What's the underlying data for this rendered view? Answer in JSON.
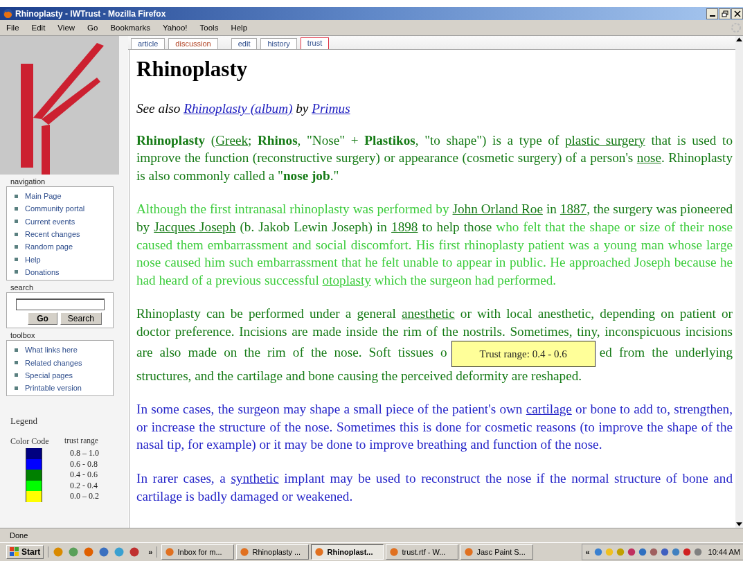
{
  "window": {
    "title": "Rhinoplasty - IWTrust - Mozilla Firefox"
  },
  "menu": [
    "File",
    "Edit",
    "View",
    "Go",
    "Bookmarks",
    "Yahoo!",
    "Tools",
    "Help"
  ],
  "tabs": [
    {
      "label": "article",
      "kind": "page",
      "selected": false
    },
    {
      "label": "discussion",
      "kind": "talk",
      "selected": false
    },
    {
      "label": "edit",
      "kind": "action",
      "selected": false
    },
    {
      "label": "history",
      "kind": "page",
      "selected": false
    },
    {
      "label": "trust",
      "kind": "page",
      "selected": true
    }
  ],
  "sidebar": {
    "navigation": {
      "heading": "navigation",
      "items": [
        "Main Page",
        "Community portal",
        "Current events",
        "Recent changes",
        "Random page",
        "Help",
        "Donations"
      ]
    },
    "search": {
      "heading": "search",
      "buttons": [
        "Go",
        "Search"
      ]
    },
    "toolbox": {
      "heading": "toolbox",
      "items": [
        "What links here",
        "Related changes",
        "Special pages",
        "Printable version"
      ]
    },
    "legend": {
      "title": "Legend",
      "color_header": "Color Code",
      "range_header": "trust range",
      "rows": [
        {
          "color": "#000080",
          "range": "0.8 – 1.0"
        },
        {
          "color": "#0000ff",
          "range": "0.6 - 0.8"
        },
        {
          "color": "#008000",
          "range": "0.4 - 0.6"
        },
        {
          "color": "#00ff00",
          "range": "0.2 - 0.4"
        },
        {
          "color": "#ffff00",
          "range": "0.0 – 0.2"
        }
      ]
    }
  },
  "article": {
    "title": "Rhinoplasty",
    "see_also": [
      {
        "kind": "text",
        "text": "See also "
      },
      {
        "kind": "link",
        "text": "Rhinoplasty (album)"
      },
      {
        "kind": "text",
        "text": " by "
      },
      {
        "kind": "link",
        "text": "Primus"
      }
    ],
    "paragraphs": [
      {
        "segments": [
          {
            "kind": "text",
            "color": "#157a15",
            "text": "**Rhinoplasty** ("
          },
          {
            "kind": "link",
            "color": "#157a15",
            "text": "Greek"
          },
          {
            "kind": "text",
            "color": "#157a15",
            "text": "; **Rhinos**, \"Nose\" + **Plastikos**, \"to shape\") is a type of "
          },
          {
            "kind": "link",
            "color": "#157a15",
            "text": "plastic surgery"
          },
          {
            "kind": "text",
            "color": "#157a15",
            "text": " that is used to improve the function (reconstructive surgery) or appearance (cosmetic surgery) of a person's "
          },
          {
            "kind": "link",
            "color": "#157a15",
            "text": "nose"
          },
          {
            "kind": "text",
            "color": "#157a15",
            "text": ". Rhinoplasty is also commonly called a \"**nose job**.\""
          }
        ]
      },
      {
        "segments": [
          {
            "kind": "text",
            "color": "#3ccc3c",
            "text": "Although the first intranasal rhinoplasty was performed by "
          },
          {
            "kind": "link",
            "color": "#157a15",
            "text": "John Orland Roe"
          },
          {
            "kind": "text",
            "color": "#157a15",
            "text": " in "
          },
          {
            "kind": "link",
            "color": "#157a15",
            "text": "1887"
          },
          {
            "kind": "text",
            "color": "#157a15",
            "text": ", the surgery was pioneered by "
          },
          {
            "kind": "link",
            "color": "#157a15",
            "text": "Jacques Joseph"
          },
          {
            "kind": "text",
            "color": "#157a15",
            "text": " (b. Jakob Lewin Joseph) in "
          },
          {
            "kind": "link",
            "color": "#157a15",
            "text": "1898"
          },
          {
            "kind": "text",
            "color": "#157a15",
            "text": " to help those "
          },
          {
            "kind": "text",
            "color": "#3ccc3c",
            "text": "who felt that the shape or size of their nose caused them embarrassment and social discomfort. His first rhinoplasty patient was a young man whose large nose caused him such embarrassment that he felt unable to appear in public. He approached Joseph because he had heard of a previous successful "
          },
          {
            "kind": "link",
            "color": "#3ccc3c",
            "text": "otoplasty"
          },
          {
            "kind": "text",
            "color": "#3ccc3c",
            "text": " which the surgeon had performed."
          }
        ]
      },
      {
        "segments": [
          {
            "kind": "text",
            "color": "#157a15",
            "text": "Rhinoplasty can be performed under a general "
          },
          {
            "kind": "link",
            "color": "#157a15",
            "text": "anesthetic"
          },
          {
            "kind": "text",
            "color": "#157a15",
            "text": " or with local anesthetic, depending on patient or doctor preference. Incisions are made inside the rim of the nostrils. Sometimes, tiny, inconspicuous incisions are also made on the rim of the nose. Soft tissues o"
          },
          {
            "kind": "tooltip",
            "text": "Trust range: 0.4 - 0.6"
          },
          {
            "kind": "text",
            "color": "#157a15",
            "text": "ed from the underlying structures, and the cartilage and bone causing the perceived deformity are reshaped."
          }
        ]
      },
      {
        "segments": [
          {
            "kind": "text",
            "color": "#2424c8",
            "text": "In some cases, the surgeon may shape a small piece of the patient's own "
          },
          {
            "kind": "link",
            "color": "#2424c8",
            "text": "cartilage"
          },
          {
            "kind": "text",
            "color": "#2424c8",
            "text": " or bone to add to, strengthen, or increase the structure of the nose. Sometimes this is done for cosmetic reasons (to improve the shape of the nasal tip, for example) or it may be done to improve breathing and function of the nose."
          }
        ]
      },
      {
        "segments": [
          {
            "kind": "text",
            "color": "#2424c8",
            "text": "In rarer cases, a "
          },
          {
            "kind": "link",
            "color": "#2424c8",
            "text": "synthetic"
          },
          {
            "kind": "text",
            "color": "#2424c8",
            "text": " implant may be used to reconstruct the nose if the normal structure of bone and cartilage is badly damaged or weakened."
          }
        ]
      }
    ]
  },
  "status_bar": {
    "text": "Done"
  },
  "taskbar": {
    "start": "Start",
    "more": "»",
    "tasks": [
      {
        "label": "Inbox for m...",
        "selected": false
      },
      {
        "label": "Rhinoplasty ...",
        "selected": false
      },
      {
        "label": "Rhinoplast...",
        "selected": true
      },
      {
        "label": "trust.rtf - W...",
        "selected": false
      },
      {
        "label": "Jasc Paint S...",
        "selected": false
      }
    ],
    "tray_toggle": "«",
    "clock": "10:44 AM"
  }
}
